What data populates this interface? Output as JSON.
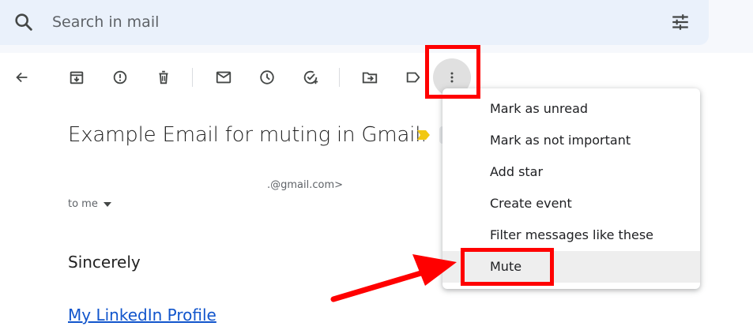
{
  "search": {
    "placeholder": "Search in mail"
  },
  "email": {
    "subject": "Example Email for muting in Gmail.",
    "sender": ".@gmail.com>",
    "recipient": "to me",
    "body_closing": "Sincerely",
    "link_text": "My LinkedIn Profile"
  },
  "menu": {
    "items": [
      {
        "label": "Mark as unread"
      },
      {
        "label": "Mark as not important"
      },
      {
        "label": "Add star"
      },
      {
        "label": "Create event"
      },
      {
        "label": "Filter messages like these"
      },
      {
        "label": "Mute"
      }
    ]
  },
  "icons": {
    "search": "search-icon",
    "filter": "tune-icon",
    "back": "arrow-back-icon",
    "archive": "archive-icon",
    "spam": "report-spam-icon",
    "delete": "trash-icon",
    "unread": "mail-icon",
    "snooze": "clock-icon",
    "task": "add-task-icon",
    "move": "move-to-folder-icon",
    "label": "label-icon",
    "more": "more-vert-icon",
    "important": "important-marker-icon"
  },
  "colors": {
    "search_bg": "#eaf1fb",
    "page_bg": "#f6f8fc",
    "important_marker": "#f2c811",
    "link": "#1155cc",
    "annotation": "#ff0000"
  }
}
